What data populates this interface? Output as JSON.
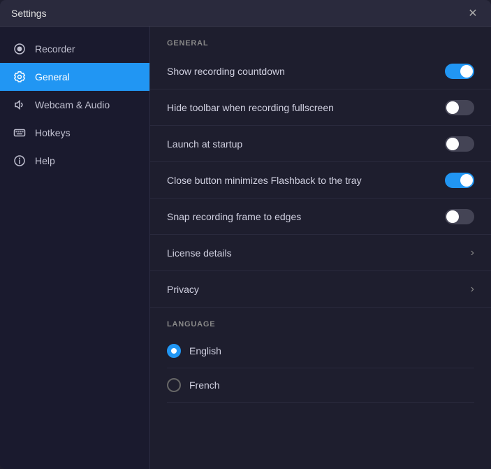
{
  "window": {
    "title": "Settings",
    "close_label": "✕"
  },
  "sidebar": {
    "items": [
      {
        "id": "recorder",
        "label": "Recorder",
        "icon": "record-icon",
        "active": false
      },
      {
        "id": "general",
        "label": "General",
        "icon": "gear-icon",
        "active": true
      },
      {
        "id": "webcam-audio",
        "label": "Webcam & Audio",
        "icon": "speaker-icon",
        "active": false
      },
      {
        "id": "hotkeys",
        "label": "Hotkeys",
        "icon": "keyboard-icon",
        "active": false
      },
      {
        "id": "help",
        "label": "Help",
        "icon": "info-icon",
        "active": false
      }
    ]
  },
  "general": {
    "section_label": "GENERAL",
    "settings": [
      {
        "id": "show-countdown",
        "label": "Show recording countdown",
        "toggle": "on"
      },
      {
        "id": "hide-toolbar",
        "label": "Hide toolbar when recording fullscreen",
        "toggle": "off"
      },
      {
        "id": "launch-startup",
        "label": "Launch at startup",
        "toggle": "off"
      },
      {
        "id": "close-minimize",
        "label": "Close button minimizes Flashback to the tray",
        "toggle": "on"
      },
      {
        "id": "snap-frame",
        "label": "Snap recording frame to edges",
        "toggle": "off"
      }
    ],
    "links": [
      {
        "id": "license",
        "label": "License details"
      },
      {
        "id": "privacy",
        "label": "Privacy"
      }
    ],
    "language_section": "LANGUAGE",
    "languages": [
      {
        "id": "english",
        "label": "English",
        "selected": true
      },
      {
        "id": "french",
        "label": "French",
        "selected": false
      }
    ]
  }
}
